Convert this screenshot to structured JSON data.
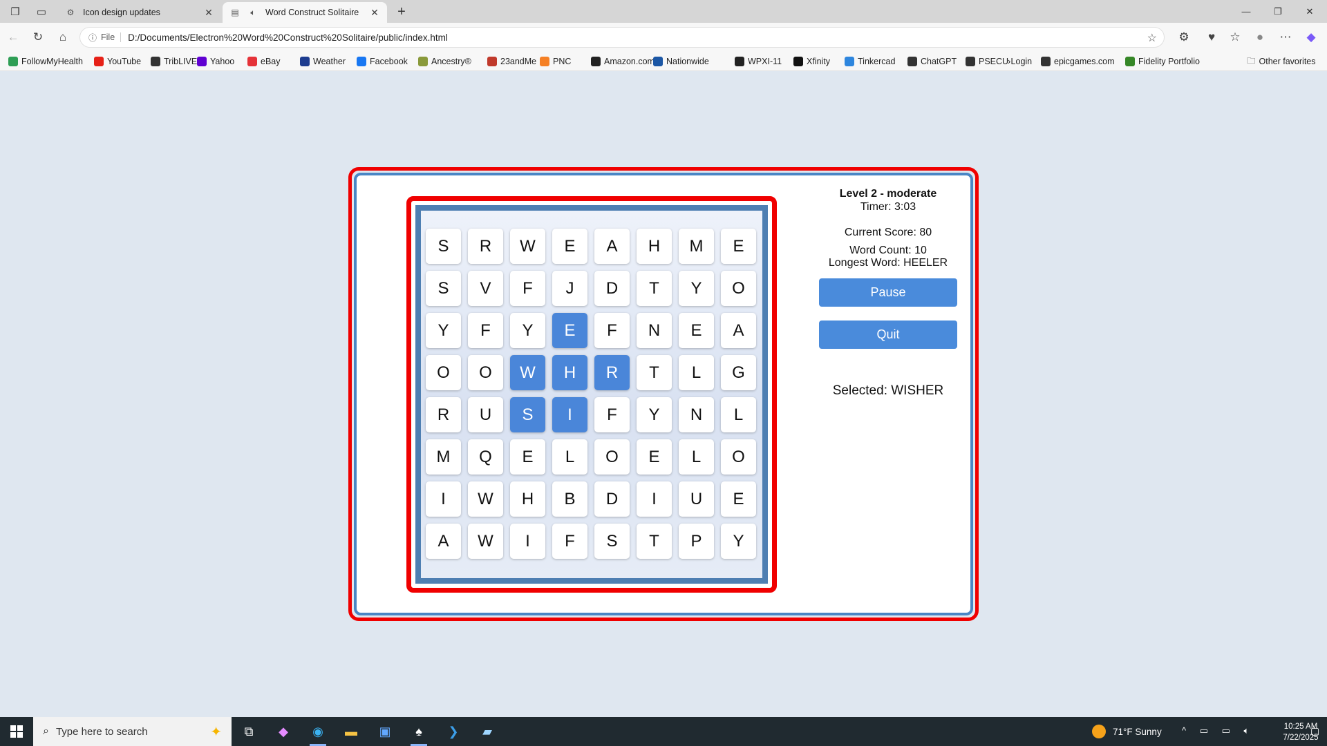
{
  "browser": {
    "tabs": [
      {
        "title": "Icon design updates",
        "icon": "gear-icon",
        "active": false
      },
      {
        "title": "Word Construct Solitaire",
        "icon": "speaker-icon",
        "active": true
      }
    ],
    "address": {
      "chip": "File",
      "url": "D:/Documents/Electron%20Word%20Construct%20Solitaire/public/index.html"
    },
    "bookmarks": [
      {
        "label": "FollowMyHealth",
        "color": "#2e9e55"
      },
      {
        "label": "YouTube",
        "color": "#e62117"
      },
      {
        "label": "TribLIVE",
        "color": "#333333"
      },
      {
        "label": "Yahoo",
        "color": "#6001d2"
      },
      {
        "label": "eBay",
        "color": "#e53238"
      },
      {
        "label": "Weather",
        "color": "#1d3c8f"
      },
      {
        "label": "Facebook",
        "color": "#1877f2"
      },
      {
        "label": "Ancestry®",
        "color": "#8a9a3b"
      },
      {
        "label": "23andMe",
        "color": "#c0392b"
      },
      {
        "label": "PNC",
        "color": "#f58025"
      },
      {
        "label": "Amazon.com",
        "color": "#222222"
      },
      {
        "label": "Nationwide",
        "color": "#1c57a5"
      },
      {
        "label": "WPXI-11",
        "color": "#222222"
      },
      {
        "label": "Xfinity",
        "color": "#111111"
      },
      {
        "label": "Tinkercad",
        "color": "#2e86de"
      },
      {
        "label": "ChatGPT",
        "color": "#333333"
      },
      {
        "label": "PSECU Login",
        "color": "#333333"
      },
      {
        "label": "epicgames.com",
        "color": "#333333"
      },
      {
        "label": "Fidelity Portfolio",
        "color": "#368727"
      }
    ],
    "other_favorites": "Other favorites"
  },
  "game": {
    "level": "Level 2 - moderate",
    "timer": "Timer: 3:03",
    "score": "Current Score: 80",
    "word_count": "Word Count: 10",
    "longest_word": "Longest Word: HEELER",
    "pause_label": "Pause",
    "quit_label": "Quit",
    "selected": "Selected: WISHER",
    "grid": [
      [
        "S",
        "R",
        "W",
        "E",
        "A",
        "H",
        "M",
        "E"
      ],
      [
        "S",
        "V",
        "F",
        "J",
        "D",
        "T",
        "Y",
        "O"
      ],
      [
        "Y",
        "F",
        "Y",
        "E",
        "F",
        "N",
        "E",
        "A"
      ],
      [
        "O",
        "O",
        "W",
        "H",
        "R",
        "T",
        "L",
        "G"
      ],
      [
        "R",
        "U",
        "S",
        "I",
        "F",
        "Y",
        "N",
        "L"
      ],
      [
        "M",
        "Q",
        "E",
        "L",
        "O",
        "E",
        "L",
        "O"
      ],
      [
        "I",
        "W",
        "H",
        "B",
        "D",
        "I",
        "U",
        "E"
      ],
      [
        "A",
        "W",
        "I",
        "F",
        "S",
        "T",
        "P",
        "Y"
      ]
    ],
    "selected_cells": [
      [
        2,
        3
      ],
      [
        3,
        2
      ],
      [
        3,
        3
      ],
      [
        3,
        4
      ],
      [
        4,
        2
      ],
      [
        4,
        3
      ]
    ],
    "colors": {
      "selected": "#4a86d9",
      "frame": "#f00000",
      "panel_border": "#4a86c5"
    }
  },
  "taskbar": {
    "search_placeholder": "Type here to search",
    "weather": "71°F  Sunny",
    "time": "10:25 AM",
    "date": "7/22/2025"
  }
}
